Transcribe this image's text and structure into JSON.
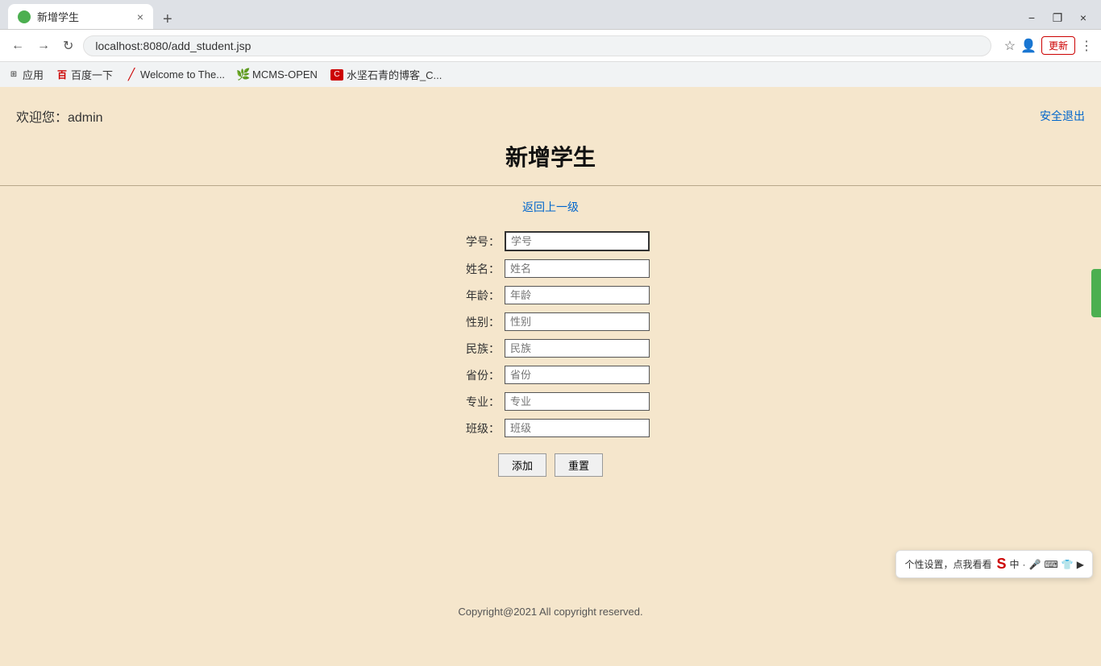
{
  "browser": {
    "tab_title": "新增学生",
    "tab_close": "×",
    "tab_new": "+",
    "address": "localhost:8080/add_student.jsp",
    "window_min": "−",
    "window_restore": "❐",
    "window_close": "×",
    "update_label": "更新",
    "update_extra": "⋮"
  },
  "bookmarks": [
    {
      "id": "apps",
      "icon": "⊞",
      "label": "应用"
    },
    {
      "id": "baidu",
      "icon": "百",
      "label": "百度一下"
    },
    {
      "id": "welcome",
      "icon": "/",
      "label": "Welcome to The..."
    },
    {
      "id": "mcms",
      "icon": "🌿",
      "label": "MCMS-OPEN"
    },
    {
      "id": "csdn",
      "icon": "C",
      "label": "水坚石青的博客_C..."
    }
  ],
  "page": {
    "welcome": "欢迎您：admin",
    "logout": "安全退出",
    "title": "新增学生",
    "back_link": "返回上一级",
    "form_fields": [
      {
        "id": "student-id",
        "label": "学号：",
        "placeholder": "学号"
      },
      {
        "id": "name",
        "label": "姓名：",
        "placeholder": "姓名"
      },
      {
        "id": "age",
        "label": "年龄：",
        "placeholder": "年龄"
      },
      {
        "id": "gender",
        "label": "性别：",
        "placeholder": "性别"
      },
      {
        "id": "nation",
        "label": "民族：",
        "placeholder": "民族"
      },
      {
        "id": "province",
        "label": "省份：",
        "placeholder": "省份"
      },
      {
        "id": "major",
        "label": "专业：",
        "placeholder": "专业"
      },
      {
        "id": "class",
        "label": "班级：",
        "placeholder": "班级"
      }
    ],
    "btn_add": "添加",
    "btn_reset": "重置",
    "footer": "Copyright@2021 All copyright reserved.",
    "widget_tooltip": "个性设置，点我看看"
  }
}
